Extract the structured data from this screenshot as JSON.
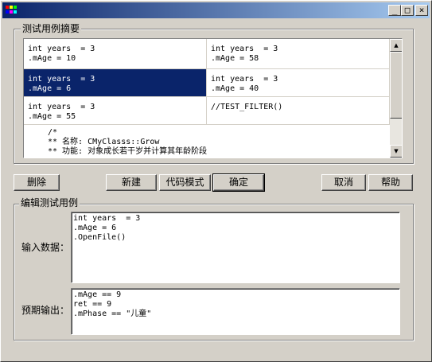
{
  "titlebar": {
    "buttons": [
      "_",
      "□",
      "×"
    ]
  },
  "summary_group": {
    "label": "测试用例摘要",
    "cells": [
      [
        "int years  = 3\n.mAge = 10",
        "int years  = 3\n.mAge = 58"
      ],
      [
        "int years  = 3\n.mAge = 6",
        "int years  = 3\n.mAge = 40"
      ],
      [
        "int years  = 3\n.mAge = 55",
        "//TEST_FILTER()"
      ]
    ],
    "note": "/*\n** 名称: CMyClasss::Grow\n** 功能: 对象成长若干岁并计算其年龄阶段"
  },
  "buttons": {
    "delete": "删除",
    "new": "新建",
    "code_mode": "代码模式",
    "ok": "确定",
    "cancel": "取消",
    "help": "帮助"
  },
  "edit_group": {
    "label": "编辑测试用例",
    "input_label": "输入数据：",
    "input_value": "int years  = 3\n.mAge = 6\n.OpenFile()",
    "output_label": "预期输出：",
    "output_value": ".mAge == 9\nret == 9\n.mPhase == \"儿童\""
  }
}
